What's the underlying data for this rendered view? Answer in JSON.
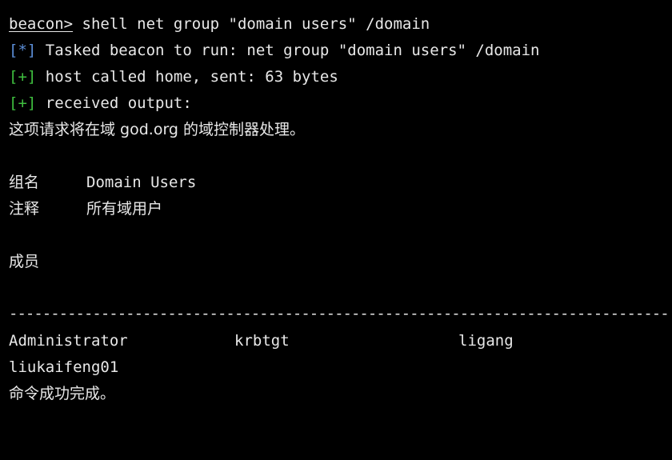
{
  "command": {
    "prompt": "beacon>",
    "text": " shell net group \"domain users\" /domain"
  },
  "tasked": {
    "tag": "[*]",
    "text": " Tasked beacon to run: net group \"domain users\" /domain"
  },
  "host_called": {
    "tag": "[+]",
    "text": " host called home, sent: 63 bytes"
  },
  "received": {
    "tag": "[+]",
    "text": " received output:"
  },
  "output": {
    "dc_line": "这项请求将在域 god.org 的域控制器处理。",
    "group_label": "组名",
    "group_value": "Domain Users",
    "comment_label": "注释",
    "comment_value": "所有域用户",
    "members_label": "成员",
    "separator": "-------------------------------------------------------------------------------",
    "members": [
      "Administrator",
      "krbtgt",
      "ligang",
      "liukaifeng01"
    ],
    "completed": "命令成功完成。"
  },
  "colors": {
    "background": "#000000",
    "foreground": "#e8e8e8",
    "info_tag": "#5b8dd6",
    "ok_tag": "#3fbf3f"
  }
}
